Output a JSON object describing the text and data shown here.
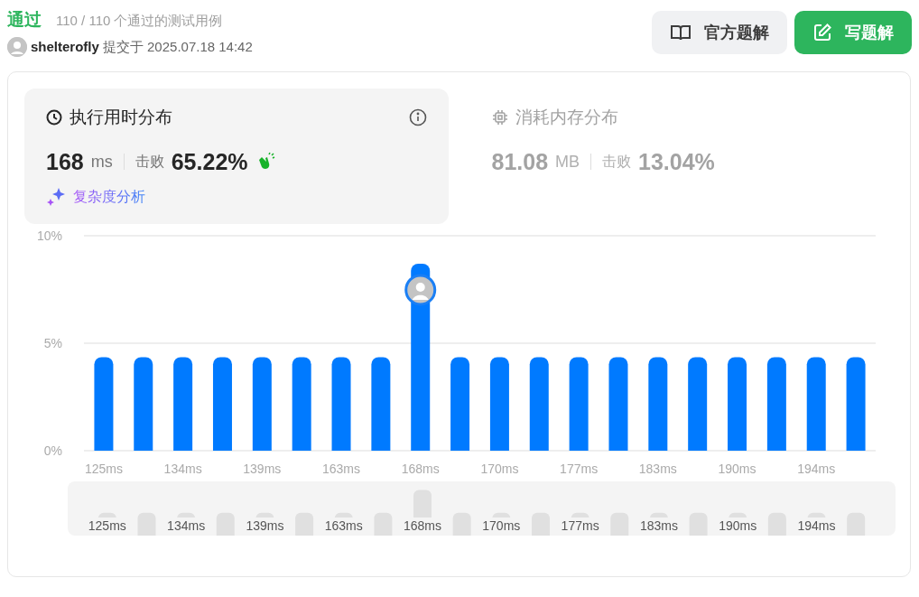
{
  "header": {
    "status": "通过",
    "summary": "110 / 110 个通过的测试用例",
    "user": "shelterofly",
    "submitted": "提交于 2025.07.18 14:42"
  },
  "buttons": [
    {
      "label": "官方题解",
      "kind": "secondary"
    },
    {
      "label": "写题解",
      "kind": "primary"
    }
  ],
  "stats": [
    {
      "title": "执行用时分布",
      "kind": "runtime",
      "selected": true,
      "value": "168",
      "unit": "ms",
      "beat_label": "击败",
      "beat": "65.22%",
      "link": "复杂度分析"
    },
    {
      "title": "消耗内存分布",
      "kind": "memory",
      "selected": false,
      "value": "81.08",
      "unit": "MB",
      "beat_label": "击败",
      "beat": "13.04%"
    }
  ],
  "chart": {
    "chart_data": {
      "type": "bar",
      "categories": [
        "125ms",
        null,
        "134ms",
        null,
        "139ms",
        null,
        "163ms",
        null,
        "168ms",
        null,
        "170ms",
        null,
        "177ms",
        null,
        "183ms",
        null,
        "190ms",
        null,
        "194ms",
        null
      ],
      "series": [
        {
          "color": "#007aff",
          "values": [
            4.35,
            4.35,
            4.35,
            4.35,
            4.35,
            4.35,
            4.35,
            4.35,
            8.7,
            4.35,
            4.35,
            4.35,
            4.35,
            4.35,
            4.35,
            4.35,
            4.35,
            4.35,
            4.35,
            4.35
          ]
        }
      ],
      "ylim": [
        0,
        10
      ],
      "yticks": [
        {
          "value": 0,
          "label": "0%"
        },
        {
          "value": 5,
          "label": "5%"
        },
        {
          "value": 10,
          "label": "10%"
        }
      ]
    },
    "bars": [
      {
        "selected": false
      },
      {
        "selected": false
      },
      {
        "selected": false
      },
      {
        "selected": false
      },
      {
        "selected": false
      },
      {
        "selected": false
      },
      {
        "selected": false
      },
      {
        "selected": false
      },
      {
        "selected": true
      },
      {
        "selected": false
      },
      {
        "selected": false
      },
      {
        "selected": false
      },
      {
        "selected": false
      },
      {
        "selected": false
      },
      {
        "selected": false
      },
      {
        "selected": false
      },
      {
        "selected": false
      },
      {
        "selected": false
      },
      {
        "selected": false
      },
      {
        "selected": false
      }
    ]
  },
  "overview": {
    "labels": [
      "125ms",
      "134ms",
      "139ms",
      "163ms",
      "168ms",
      "170ms",
      "177ms",
      "183ms",
      "190ms",
      "194ms"
    ]
  }
}
